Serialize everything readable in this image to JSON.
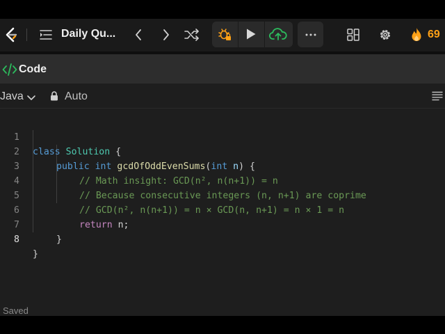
{
  "header": {
    "problem_title": "Daily Qu...",
    "streak_count": "69",
    "streak_color": "#ffa116",
    "icons": [
      "leetcode-logo",
      "problem-list-icon",
      "prev-icon",
      "next-icon",
      "shuffle-icon",
      "debug-icon",
      "run-icon",
      "submit-icon",
      "more-icon",
      "layout-icon",
      "gear-icon",
      "fire-icon"
    ]
  },
  "code_panel": {
    "title": "Code",
    "language": "Java",
    "mode": "Auto",
    "status": "Saved"
  },
  "code": {
    "line_numbers": [
      "1",
      "2",
      "3",
      "4",
      "5",
      "6",
      "7",
      "8"
    ],
    "active_line": 8,
    "l1": {
      "kw": "class",
      "cls": "Solution",
      "tail": " {"
    },
    "l2": {
      "kw1": "public",
      "kw2": "int",
      "fn": "gcdOfOddEvenSums",
      "open": "(",
      "kw3": "int",
      "param": "n",
      "tail": ") {"
    },
    "l3": "// Math insight: GCD(n², n(n+1)) = n",
    "l4": "// Because consecutive integers (n, n+1) are coprime",
    "l5": "// GCD(n², n(n+1)) = n × GCD(n, n+1) = n × 1 = n",
    "l6": {
      "kw": "return",
      "tail": " n;"
    },
    "l7": "}",
    "l8": "}"
  }
}
